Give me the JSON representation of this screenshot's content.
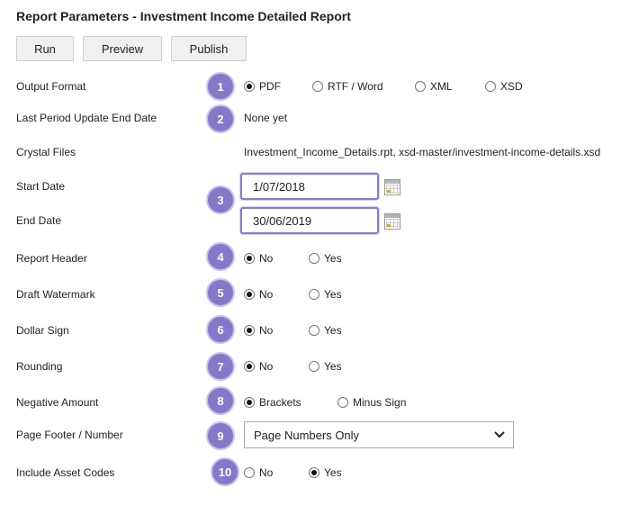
{
  "title": "Report Parameters - Investment Income Detailed Report",
  "toolbar": {
    "run": "Run",
    "preview": "Preview",
    "publish": "Publish"
  },
  "colors": {
    "badge": "#8677c9",
    "highlight_border": "#8a7bd0"
  },
  "badges": [
    "1",
    "2",
    "3",
    "4",
    "5",
    "6",
    "7",
    "8",
    "9",
    "10"
  ],
  "output_format": {
    "label": "Output Format",
    "options": [
      "PDF",
      "RTF / Word",
      "XML",
      "XSD"
    ],
    "selected": "PDF"
  },
  "last_period": {
    "label": "Last Period Update End Date",
    "value": "None yet"
  },
  "crystal_files": {
    "label": "Crystal Files",
    "value": "Investment_Income_Details.rpt, xsd-master/investment-income-details.xsd"
  },
  "start_date": {
    "label": "Start Date",
    "value": "1/07/2018"
  },
  "end_date": {
    "label": "End Date",
    "value": "30/06/2019"
  },
  "report_header": {
    "label": "Report Header",
    "options": [
      "No",
      "Yes"
    ],
    "selected": "No"
  },
  "draft_watermark": {
    "label": "Draft Watermark",
    "options": [
      "No",
      "Yes"
    ],
    "selected": "No"
  },
  "dollar_sign": {
    "label": "Dollar Sign",
    "options": [
      "No",
      "Yes"
    ],
    "selected": "No"
  },
  "rounding": {
    "label": "Rounding",
    "options": [
      "No",
      "Yes"
    ],
    "selected": "No"
  },
  "negative_amount": {
    "label": "Negative Amount",
    "options": [
      "Brackets",
      "Minus Sign"
    ],
    "selected": "Brackets"
  },
  "page_footer": {
    "label": "Page Footer / Number",
    "selected": "Page Numbers Only"
  },
  "include_asset_codes": {
    "label": "Include Asset Codes",
    "options": [
      "No",
      "Yes"
    ],
    "selected": "Yes"
  }
}
